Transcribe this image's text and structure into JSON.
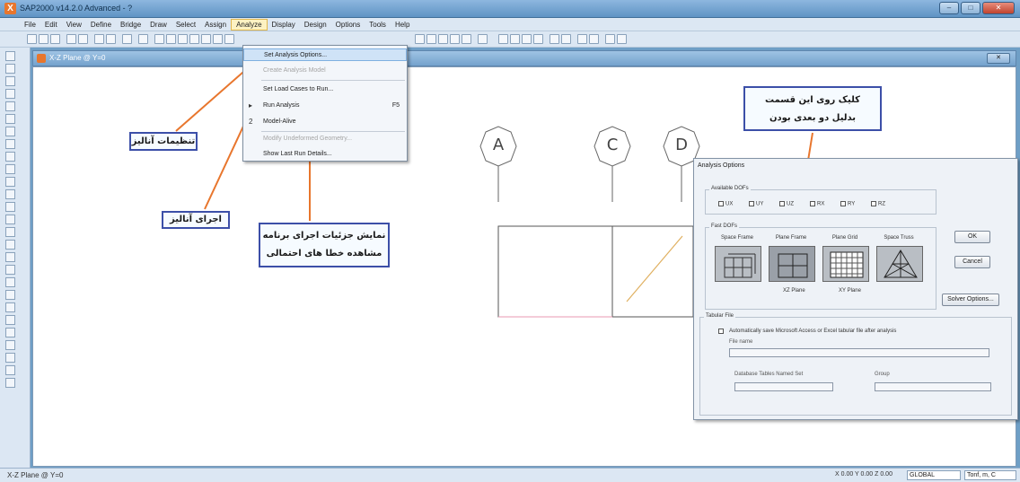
{
  "window": {
    "title": "SAP2000 v14.2.0 Advanced - ?",
    "logo_letter": "X",
    "minimize": "–",
    "maximize": "□",
    "close": "✕"
  },
  "menubar": {
    "items": [
      "File",
      "Edit",
      "View",
      "Define",
      "Bridge",
      "Draw",
      "Select",
      "Assign",
      "Analyze",
      "Display",
      "Design",
      "Options",
      "Tools",
      "Help"
    ]
  },
  "analyze_menu": {
    "items": [
      {
        "label": "Set Analysis Options...",
        "key": "",
        "glyph": "",
        "disabled": false,
        "highlight": true
      },
      {
        "label": "Create Analysis Model",
        "key": "",
        "glyph": "",
        "disabled": true,
        "highlight": false
      },
      {
        "label": "Set Load Cases to Run...",
        "key": "",
        "glyph": "",
        "disabled": false,
        "highlight": false
      },
      {
        "label": "Run Analysis",
        "key": "F5",
        "glyph": "▸",
        "disabled": false,
        "highlight": false
      },
      {
        "label": "Model-Alive",
        "key": "",
        "glyph": "2",
        "disabled": false,
        "highlight": false
      },
      {
        "label": "Modify Undeformed Geometry...",
        "key": "",
        "glyph": "",
        "disabled": true,
        "highlight": false
      },
      {
        "label": "Show Last Run Details...",
        "key": "",
        "glyph": "",
        "disabled": false,
        "highlight": false
      }
    ]
  },
  "document": {
    "title": "X-Z Plane @ Y=0",
    "close_label": "✕"
  },
  "grid": {
    "bubbles": [
      "A",
      "C",
      "D"
    ]
  },
  "annotations": {
    "analysis_settings": "تنظیمات آنالیز",
    "run_analysis": "اجرای آنالیز",
    "show_details_line1": "نمایش جزئیات اجرای برنامه",
    "show_details_line2": "مشاهده خطا های احتمالی",
    "click_here_line1": "کلیک روی این قسمت",
    "click_here_line2": "بدلیل دو بعدی بودن"
  },
  "dialog": {
    "title": "Analysis Options",
    "available_dofs_label": "Available DOFs",
    "dofs": [
      "UX",
      "UY",
      "UZ",
      "RX",
      "RY",
      "RZ"
    ],
    "fast_dofs_label": "Fast DOFs",
    "fast_options": [
      "Space Frame",
      "Plane Frame",
      "Plane Grid",
      "Space Truss"
    ],
    "plane_captions": [
      "XZ Plane",
      "XY Plane"
    ],
    "ok_label": "OK",
    "cancel_label": "Cancel",
    "solver_label": "Solver Options...",
    "tabular_file_label": "Tabular File",
    "auto_save_label": "Automatically save Microsoft Access or Excel tabular file after analysis",
    "file_name_label": "File name",
    "db_tables_label": "Database Tables Named Set",
    "group_label": "Group"
  },
  "statusbar": {
    "left": "X-Z Plane @ Y=0",
    "coords": "X 0.00 Y 0.00 Z 0.00",
    "coord_system": "GLOBAL",
    "units": "Tonf, m, C"
  }
}
